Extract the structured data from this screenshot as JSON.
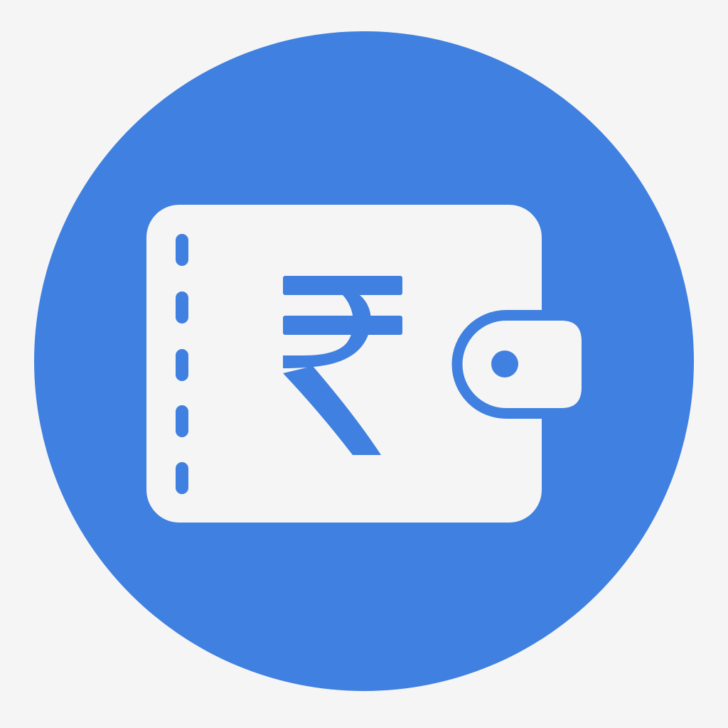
{
  "icon": {
    "name": "rupee-wallet-icon",
    "currency_symbol": "₹"
  },
  "colors": {
    "page_background": "#f5f5f5",
    "circle_fill": "#4080e0",
    "wallet_fill": "#f5f5f5"
  }
}
